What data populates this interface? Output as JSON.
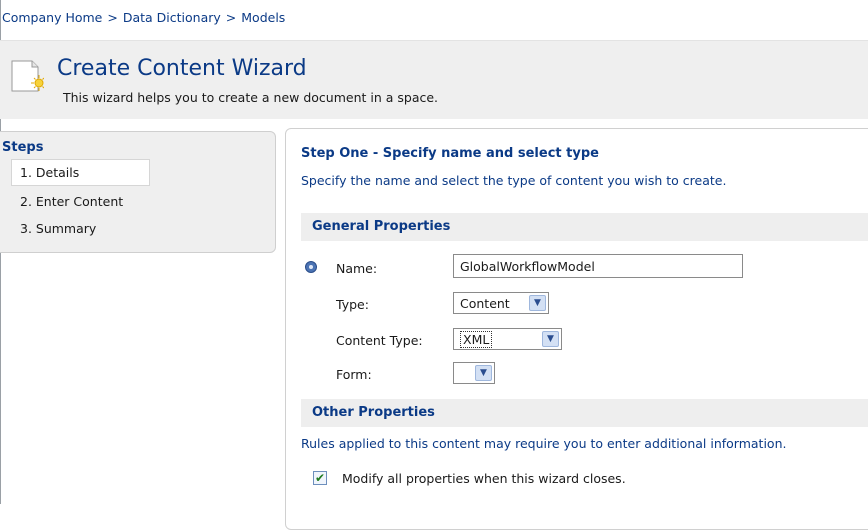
{
  "breadcrumb": {
    "items": [
      "Company Home",
      "Data Dictionary",
      "Models"
    ],
    "separator": ">"
  },
  "header": {
    "title": "Create Content Wizard",
    "subtitle": "This wizard helps you to create a new document in a space.",
    "icon": "new-document-icon"
  },
  "steps": {
    "title": "Steps",
    "items": [
      "1. Details",
      "2. Enter Content",
      "3. Summary"
    ],
    "active_index": 0
  },
  "main": {
    "heading": "Step One - Specify name and select type",
    "description": "Specify the name and select the type of content you wish to create.",
    "general_properties": {
      "title": "General Properties",
      "name_label": "Name:",
      "name_value": "GlobalWorkflowModel",
      "type_label": "Type:",
      "type_value": "Content",
      "content_type_label": "Content Type:",
      "content_type_value": "XML",
      "form_label": "Form:",
      "form_value": ""
    },
    "other_properties": {
      "title": "Other Properties",
      "rules_text": "Rules applied to this content may require you to enter additional information.",
      "modify_label": "Modify all properties when this wizard closes.",
      "modify_checked": true
    }
  },
  "colors": {
    "link_blue": "#0b3a86",
    "panel_gray": "#efefef",
    "section_gray": "#eeeeee"
  }
}
